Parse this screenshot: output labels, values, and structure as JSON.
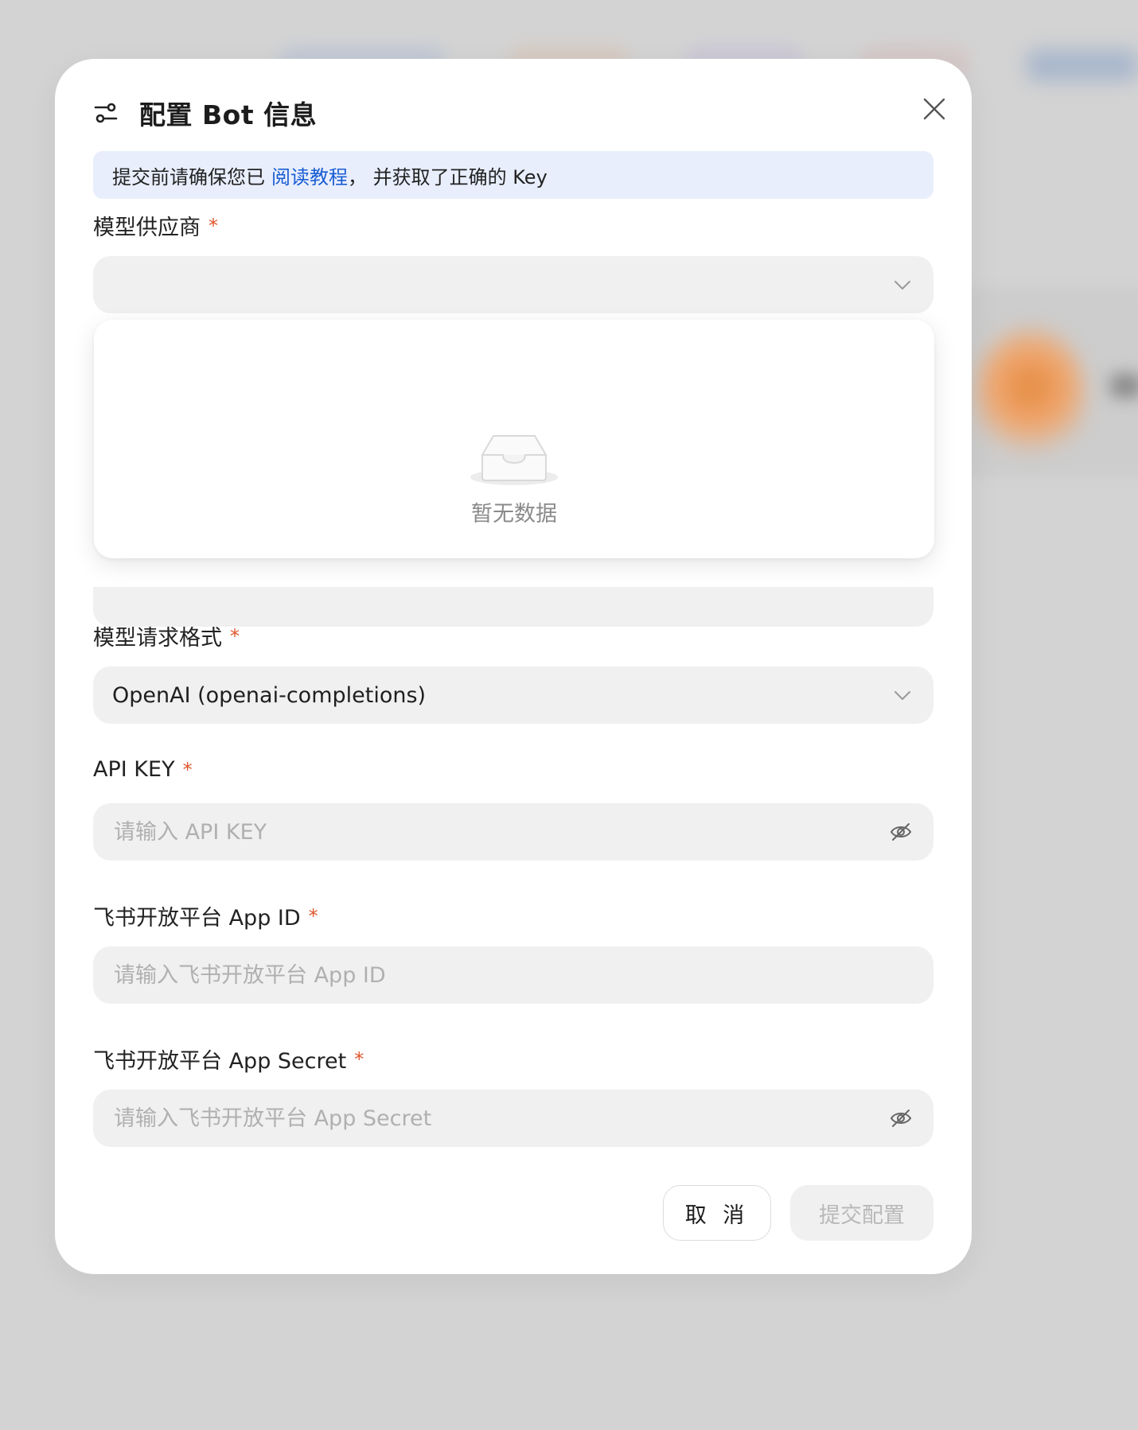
{
  "modal": {
    "title": "配置 Bot 信息",
    "notice": {
      "prefix": "提交前请确保您已",
      "link": "阅读教程",
      "suffix": "， 并获取了正确的 Key"
    },
    "required_mark": "*",
    "fields": {
      "provider": {
        "label": "模型供应商",
        "value": "",
        "dropdown_open": true,
        "empty_text": "暂无数据"
      },
      "request_format": {
        "label": "模型请求格式",
        "value": "OpenAI (openai-completions)"
      },
      "api_key": {
        "label": "API KEY",
        "placeholder": "请输入 API KEY"
      },
      "app_id": {
        "label": "飞书开放平台 App ID",
        "placeholder": "请输入飞书开放平台 App ID"
      },
      "app_secret": {
        "label": "飞书开放平台 App Secret",
        "placeholder": "请输入飞书开放平台 App Secret"
      }
    },
    "buttons": {
      "cancel": "取 消",
      "submit": "提交配置"
    }
  },
  "colors": {
    "notice_bg": "#e8eefc",
    "link": "#1a5dd3",
    "required": "#e0562b",
    "field_bg": "#f0f0f0",
    "disabled_text": "#b8b8b8"
  },
  "icons": {
    "header": "settings-sliders-icon",
    "close": "close-icon",
    "select": "chevron-down-icon",
    "password": "eye-off-icon",
    "empty": "empty-inbox-icon"
  }
}
